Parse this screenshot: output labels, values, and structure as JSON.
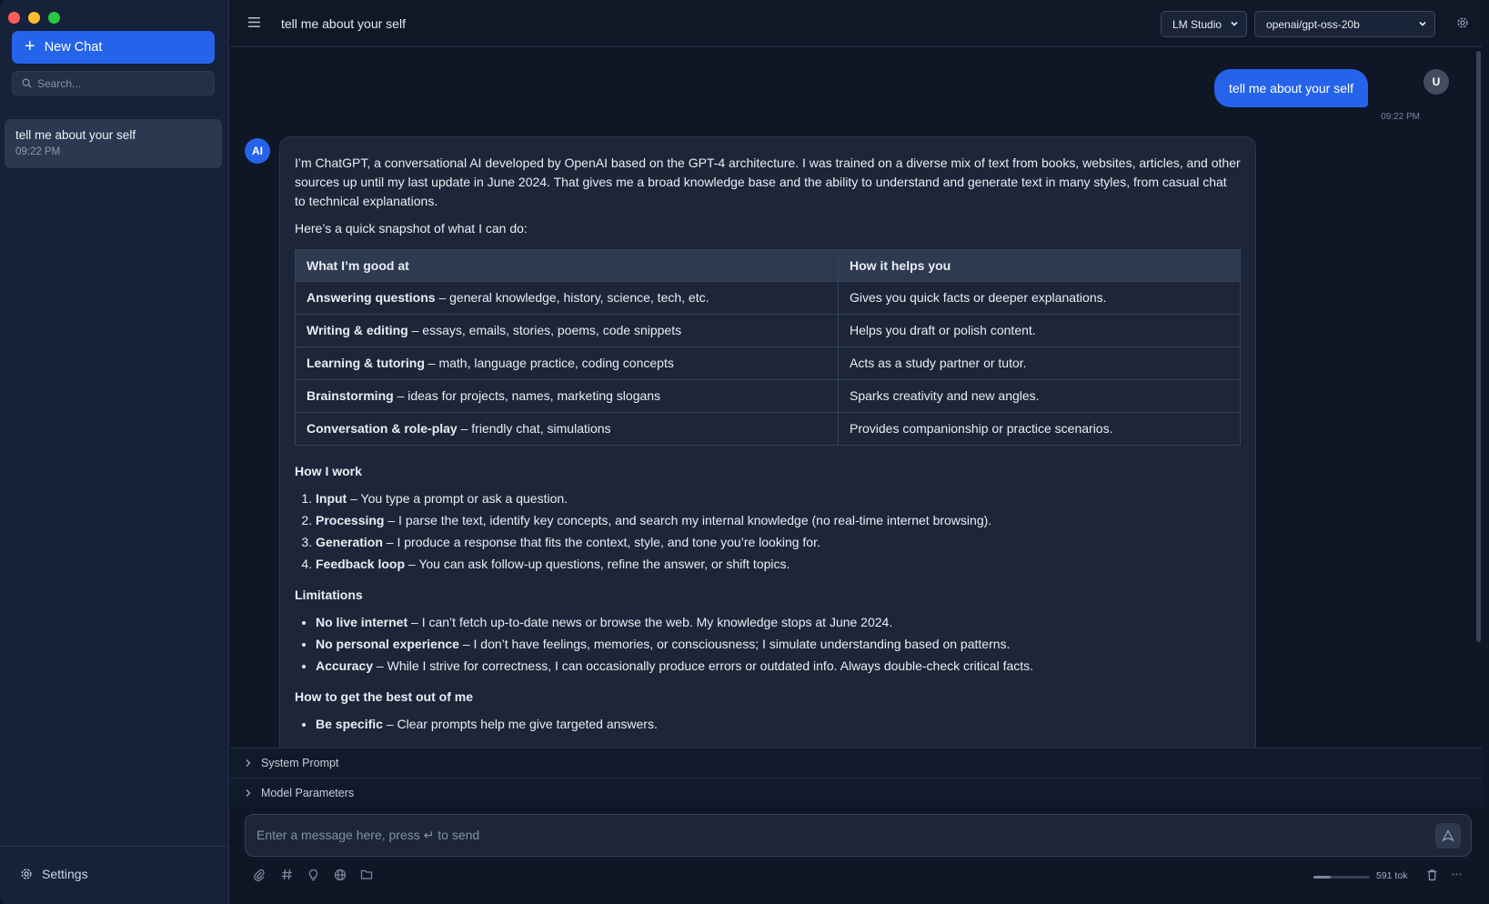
{
  "sidebar": {
    "new_chat_label": "New Chat",
    "search_placeholder": "Search...",
    "chats": [
      {
        "title": "tell me about your self",
        "time": "09:22 PM"
      }
    ],
    "settings_label": "Settings"
  },
  "header": {
    "title": "tell me about your self",
    "provider": "LM Studio",
    "model": "openai/gpt-oss-20b"
  },
  "conversation": {
    "user": {
      "avatar": "U",
      "text": "tell me about your self",
      "time": "09:22 PM"
    },
    "ai": {
      "avatar": "AI",
      "intro": "I’m ChatGPT, a conversational AI developed by OpenAI based on the GPT-4 architecture. I was trained on a diverse mix of text from books, websites, articles, and other sources up until my last update in June 2024. That gives me a broad knowledge base and the ability to understand and generate text in many styles, from casual chat to technical explanations.",
      "snapshot": "Here’s a quick snapshot of what I can do:",
      "table": {
        "headers": [
          "What I’m good at",
          "How it helps you"
        ],
        "rows": [
          {
            "b": "Answering questions",
            "t": " – general knowledge, history, science, tech, etc.",
            "h": "Gives you quick facts or deeper explanations."
          },
          {
            "b": "Writing & editing",
            "t": " – essays, emails, stories, poems, code snippets",
            "h": "Helps you draft or polish content."
          },
          {
            "b": "Learning & tutoring",
            "t": " – math, language practice, coding concepts",
            "h": "Acts as a study partner or tutor."
          },
          {
            "b": "Brainstorming",
            "t": " – ideas for projects, names, marketing slogans",
            "h": "Sparks creativity and new angles."
          },
          {
            "b": "Conversation & role-play",
            "t": " – friendly chat, simulations",
            "h": "Provides companionship or practice scenarios."
          }
        ]
      },
      "how_title": "How I work",
      "how": [
        {
          "b": "Input",
          "t": " – You type a prompt or ask a question."
        },
        {
          "b": "Processing",
          "t": " – I parse the text, identify key concepts, and search my internal knowledge (no real-time internet browsing)."
        },
        {
          "b": "Generation",
          "t": " – I produce a response that fits the context, style, and tone you’re looking for."
        },
        {
          "b": "Feedback loop",
          "t": " – You can ask follow-up questions, refine the answer, or shift topics."
        }
      ],
      "lim_title": "Limitations",
      "limitations": [
        {
          "b": "No live internet",
          "t": " – I can’t fetch up-to-date news or browse the web. My knowledge stops at June 2024."
        },
        {
          "b": "No personal experience",
          "t": " – I don’t have feelings, memories, or consciousness; I simulate understanding based on patterns."
        },
        {
          "b": "Accuracy",
          "t": " – While I strive for correctness, I can occasionally produce errors or outdated info. Always double-check critical facts."
        }
      ],
      "best_title": "How to get the best out of me",
      "best": [
        {
          "b": "Be specific",
          "t": " – Clear prompts help me give targeted answers."
        }
      ]
    }
  },
  "panels": {
    "system_prompt": "System Prompt",
    "model_parameters": "Model Parameters"
  },
  "composer": {
    "placeholder": "Enter a message here, press ↵ to send"
  },
  "footer": {
    "tokens": "591 tok",
    "context_fraction": 0.3
  }
}
